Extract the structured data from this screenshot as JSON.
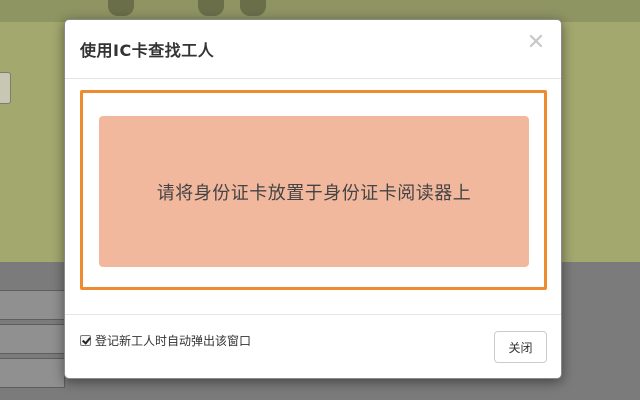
{
  "modal": {
    "title": "使用IC卡查找工人",
    "close_symbol": "✕",
    "reader_instruction": "请将身份证卡放置于身份证卡阅读器上",
    "auto_popup_checkbox": {
      "label": "登记新工人时自动弹出该窗口",
      "checked": true
    },
    "close_button_label": "关闭"
  },
  "colors": {
    "frame_border": "#ef8b2f",
    "reader_panel": "#f2b89e",
    "overlay_top": "#a3a86f",
    "overlay_bottom": "#7b7b7b"
  }
}
